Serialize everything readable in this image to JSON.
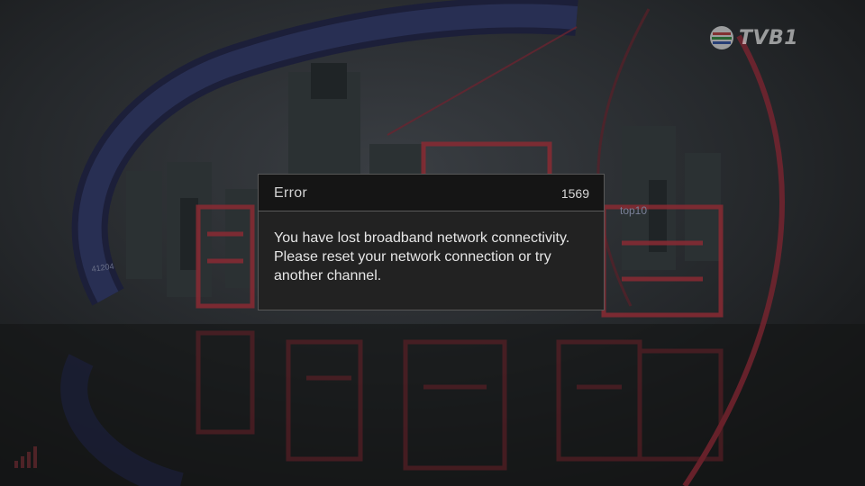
{
  "channel_logo": {
    "icon": "tvb-globe-icon",
    "text": "TVB1"
  },
  "error_dialog": {
    "title": "Error",
    "code": "1569",
    "message_lines": [
      "You have lost broadband network connectivity.",
      "Please reset your network connection or try",
      "another channel."
    ]
  },
  "background": {
    "scene_labels": [
      "top10",
      "41204"
    ]
  },
  "status": {
    "icon": "signal-bars-icon"
  },
  "colors": {
    "dialog_bg": "#222222",
    "dialog_header_bg": "#151515",
    "dialog_border": "#585858",
    "text": "#e6e6e6",
    "scene_red": "#8a2a33",
    "scene_blue": "#2a3156"
  }
}
